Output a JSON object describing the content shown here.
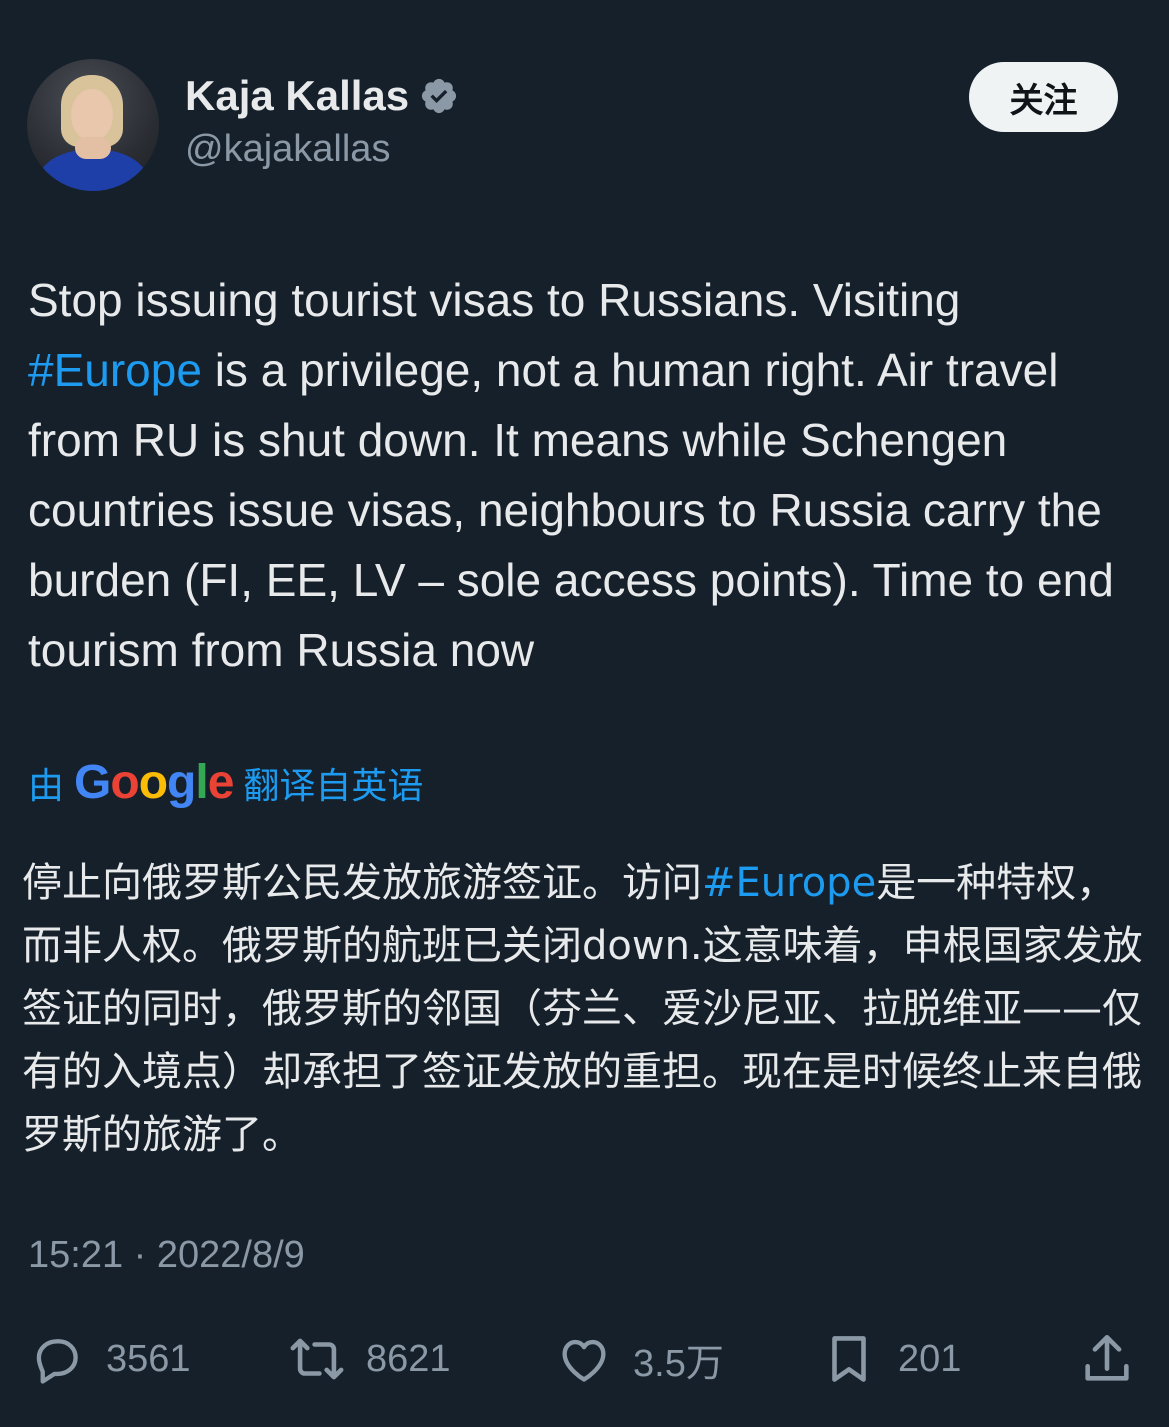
{
  "author": {
    "name": "Kaja Kallas",
    "handle": "@kajakallas",
    "verified_icon": "verified-badge-icon"
  },
  "follow_button": {
    "label": "关注"
  },
  "tweet": {
    "text_before": "Stop issuing tourist visas to Russians. Visiting ",
    "hashtag": "#Europe",
    "text_after": " is a privilege, not a human right. Air travel from RU is shut down. It means while Schengen countries issue visas, neighbours to Russia carry the burden (FI, EE, LV – sole access points). Time to end tourism from Russia now"
  },
  "translation": {
    "prefix": "由",
    "provider": "Google",
    "suffix": "翻译自英语",
    "text_before": "停止向俄罗斯公民发放旅游签证。访问",
    "hashtag": "#Europe",
    "text_after": "是一种特权，而非人权。俄罗斯的航班已关闭down.这意味着，申根国家发放签证的同时，俄罗斯的邻国（芬兰、爱沙尼亚、拉脱维亚——仅有的入境点）却承担了签证发放的重担。现在是时候终止来自俄罗斯的旅游了。"
  },
  "timestamp": "15:21 · 2022/8/9",
  "actions": {
    "reply": {
      "icon": "reply-icon",
      "count": "3561"
    },
    "retweet": {
      "icon": "retweet-icon",
      "count": "8621"
    },
    "like": {
      "icon": "heart-icon",
      "count": "3.5万"
    },
    "bookmark": {
      "icon": "bookmark-icon",
      "count": "201"
    },
    "share": {
      "icon": "share-icon"
    }
  },
  "colors": {
    "background": "#15202b",
    "text": "#e7e9ea",
    "secondary": "#8b98a5",
    "accent": "#1d9bf0"
  }
}
